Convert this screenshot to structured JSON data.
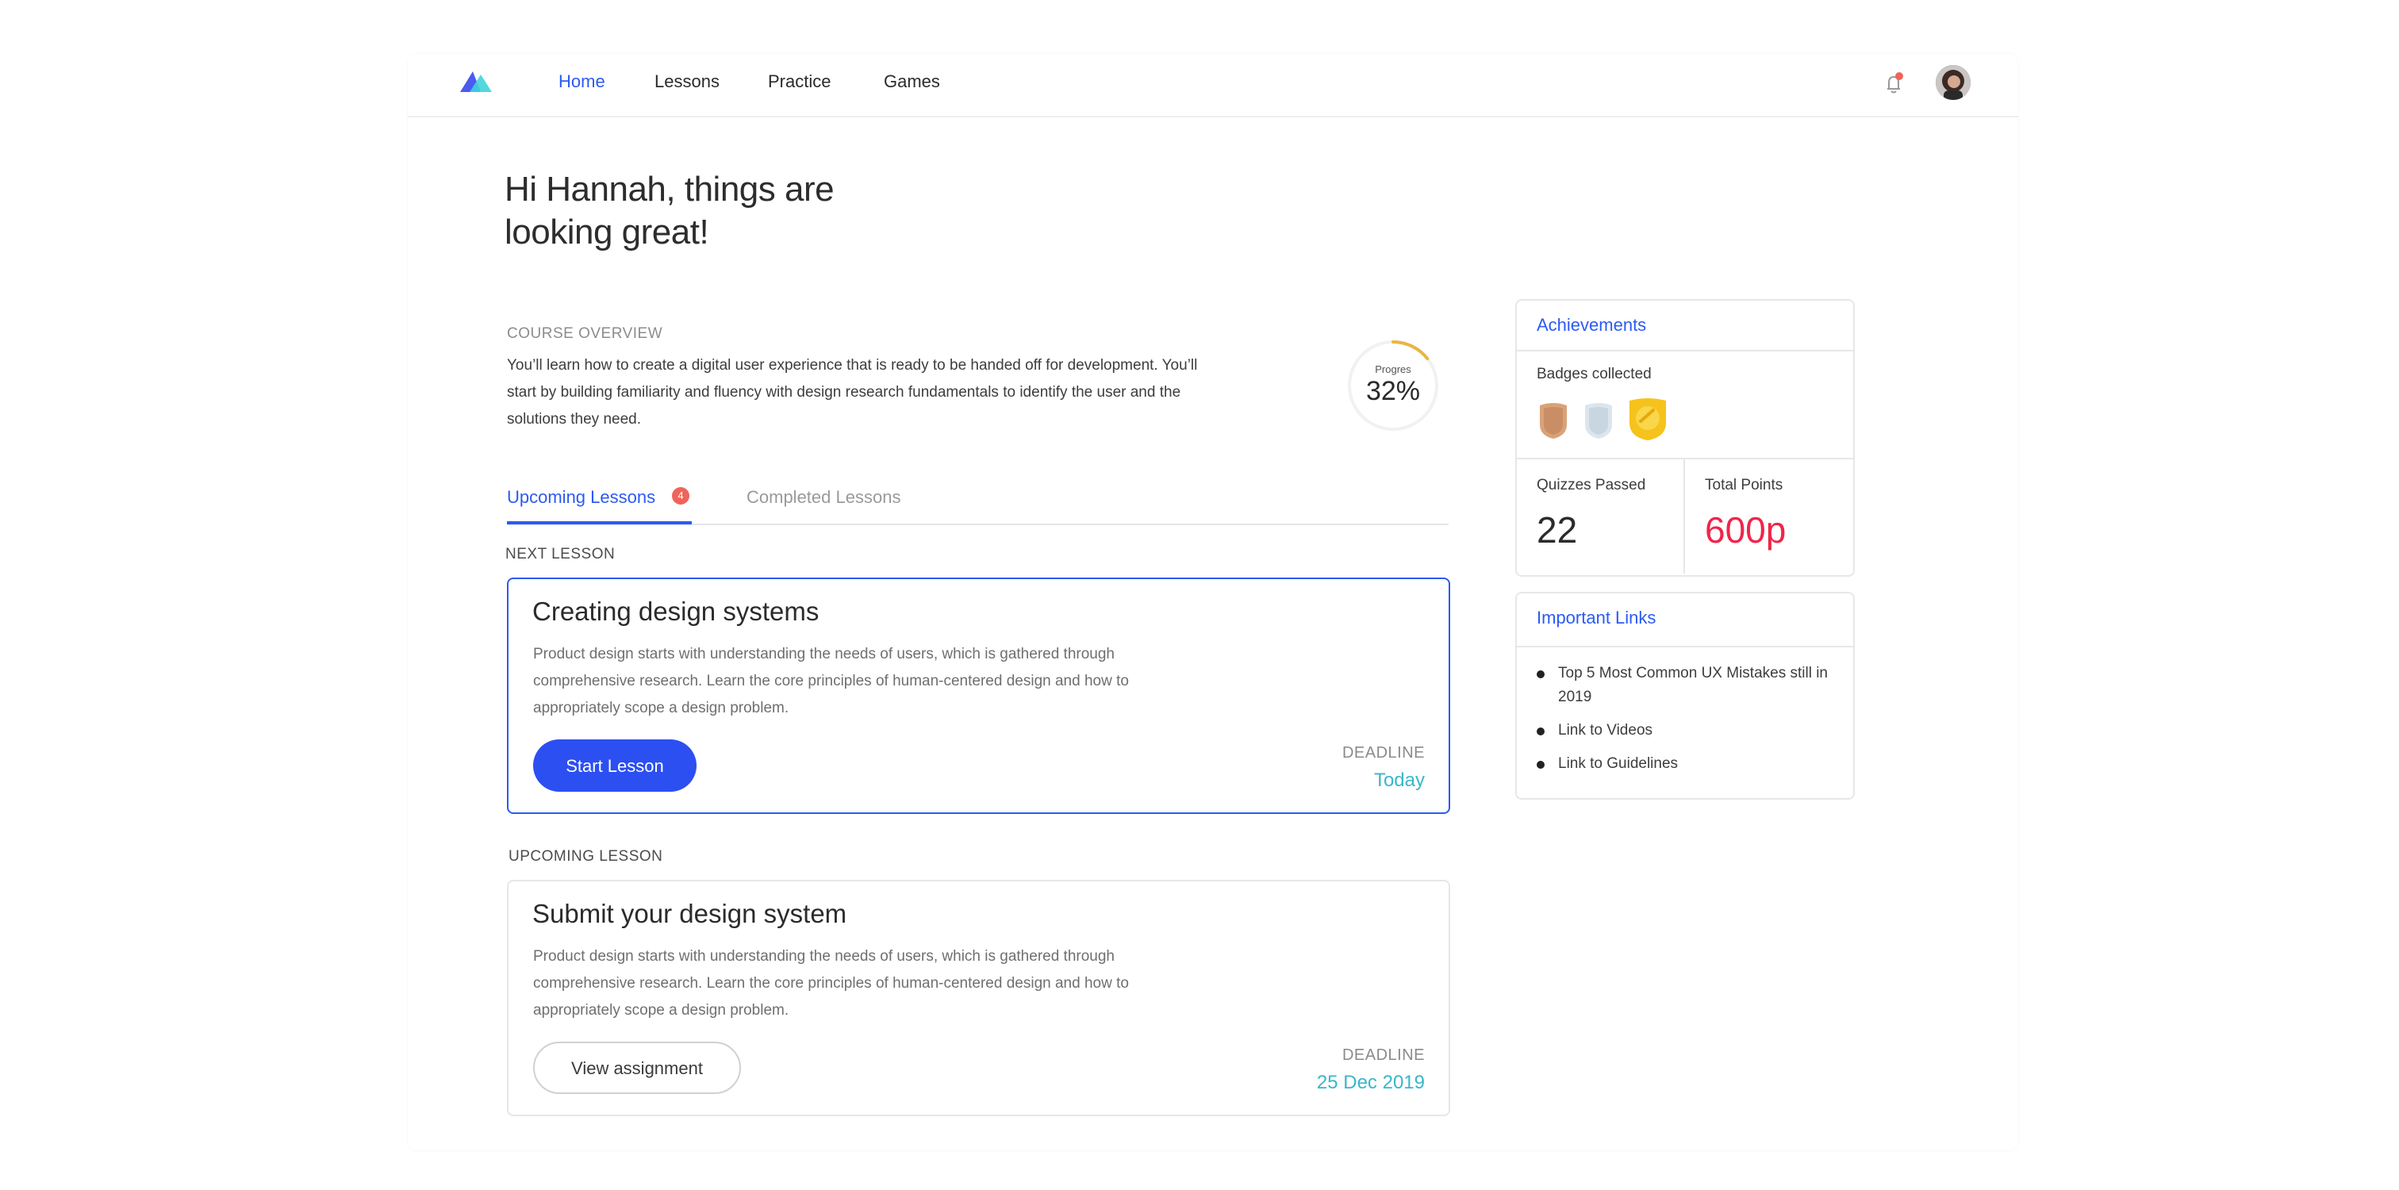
{
  "nav": {
    "items": [
      {
        "label": "Home",
        "active": true
      },
      {
        "label": "Lessons",
        "active": false
      },
      {
        "label": "Practice",
        "active": false
      },
      {
        "label": "Games",
        "active": false
      }
    ],
    "logo_icon": "logo-icon",
    "notification_icon": "bell-icon",
    "notification_dot_color": "#f0645a"
  },
  "greeting": {
    "line1": "Hi Hannah, things are",
    "line2": "looking great!"
  },
  "course": {
    "label": "COURSE OVERVIEW",
    "description": "You’ll learn how to create a digital user experience that is ready to be handed off for development. You’ll start by building familiarity and fluency with design research fundamentals to identify the user and the solutions they need.",
    "progress_label": "Progres",
    "progress_value": "32%",
    "progress_fraction": 0.32
  },
  "tabs": {
    "upcoming_label": "Upcoming Lessons",
    "upcoming_count": "4",
    "completed_label": "Completed Lessons"
  },
  "next_lesson": {
    "section_label": "NEXT LESSON",
    "title": "Creating design systems",
    "description": "Product design starts with understanding the needs of users, which is gathered through comprehensive research. Learn the core principles of human-centered design and how to appropriately scope a design problem.",
    "button_label": "Start Lesson",
    "deadline_label": "DEADLINE",
    "deadline_value": "Today"
  },
  "upcoming_lesson": {
    "section_label": "UPCOMING LESSON",
    "title": "Submit your design system",
    "description": "Product design starts with understanding the needs of users, which is gathered through comprehensive research. Learn the core principles of human-centered design and how to appropriately scope a design problem.",
    "button_label": "View assignment",
    "deadline_label": "DEADLINE",
    "deadline_value": "25 Dec 2019"
  },
  "achievements": {
    "title": "Achievements",
    "badges_label": "Badges collected",
    "badges": [
      "bronze-badge-icon",
      "silver-badge-icon",
      "gold-badge-icon"
    ],
    "quizzes_label": "Quizzes Passed",
    "quizzes_value": "22",
    "points_label": "Total Points",
    "points_value": "600p",
    "points_color": "#f0254a"
  },
  "links": {
    "title": "Important Links",
    "items": [
      "Top 5 Most Common UX Mistakes still in 2019",
      "Link to Videos",
      "Link to Guidelines"
    ]
  },
  "colors": {
    "accent": "#2c5af3",
    "deadline": "#38b7c9"
  }
}
